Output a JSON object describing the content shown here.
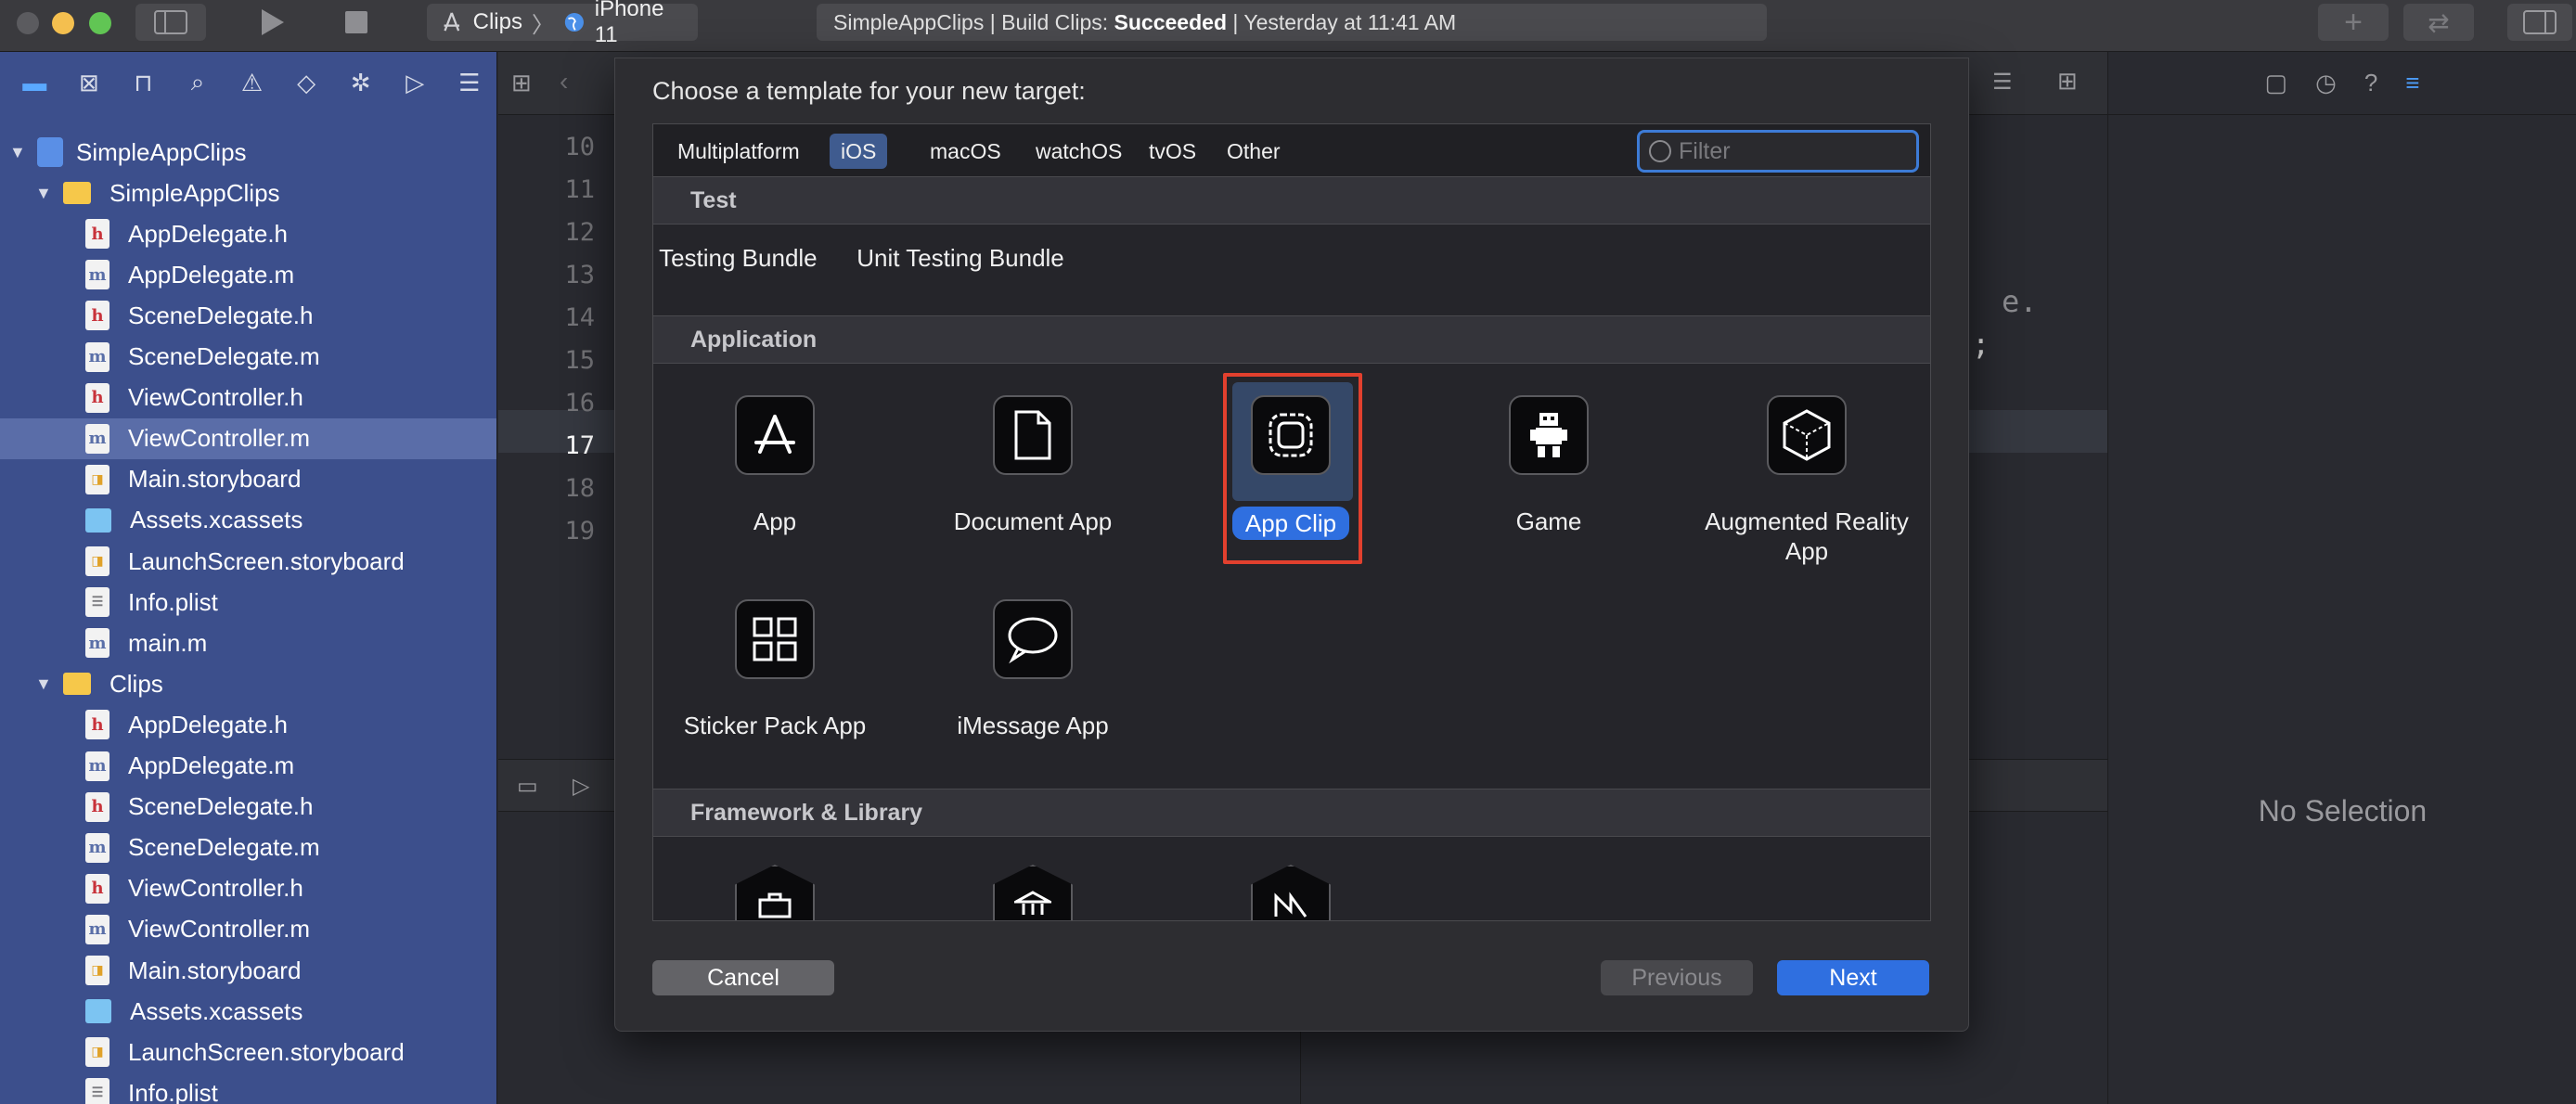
{
  "toolbar": {
    "scheme_target": "Clips",
    "scheme_device": "iPhone 11",
    "status_prefix": "SimpleAppClips | Build Clips: ",
    "status_result": "Succeeded",
    "status_suffix": " | Yesterday at 11:41 AM"
  },
  "navigator": {
    "project": "SimpleAppClips",
    "groups": [
      {
        "name": "SimpleAppClips",
        "files": [
          {
            "name": "AppDelegate.h",
            "kind": "h"
          },
          {
            "name": "AppDelegate.m",
            "kind": "m"
          },
          {
            "name": "SceneDelegate.h",
            "kind": "h"
          },
          {
            "name": "SceneDelegate.m",
            "kind": "m"
          },
          {
            "name": "ViewController.h",
            "kind": "h"
          },
          {
            "name": "ViewController.m",
            "kind": "m",
            "selected": true
          },
          {
            "name": "Main.storyboard",
            "kind": "storyboard"
          },
          {
            "name": "Assets.xcassets",
            "kind": "assets"
          },
          {
            "name": "LaunchScreen.storyboard",
            "kind": "storyboard"
          },
          {
            "name": "Info.plist",
            "kind": "plist"
          },
          {
            "name": "main.m",
            "kind": "m"
          }
        ]
      },
      {
        "name": "Clips",
        "files": [
          {
            "name": "AppDelegate.h",
            "kind": "h"
          },
          {
            "name": "AppDelegate.m",
            "kind": "m"
          },
          {
            "name": "SceneDelegate.h",
            "kind": "h"
          },
          {
            "name": "SceneDelegate.m",
            "kind": "m"
          },
          {
            "name": "ViewController.h",
            "kind": "h"
          },
          {
            "name": "ViewController.m",
            "kind": "m"
          },
          {
            "name": "Main.storyboard",
            "kind": "storyboard"
          },
          {
            "name": "Assets.xcassets",
            "kind": "assets"
          },
          {
            "name": "LaunchScreen.storyboard",
            "kind": "storyboard"
          },
          {
            "name": "Info.plist",
            "kind": "plist"
          }
        ]
      }
    ]
  },
  "editor": {
    "line_numbers": [
      "10",
      "11",
      "12",
      "13",
      "14",
      "15",
      "16",
      "17",
      "18",
      "19"
    ],
    "current_line": "17",
    "fragment_a": "e.",
    "fragment_b": ";"
  },
  "inspector": {
    "no_selection": "No Selection"
  },
  "sheet": {
    "title": "Choose a template for your new target:",
    "platform_tabs": [
      "Multiplatform",
      "iOS",
      "macOS",
      "watchOS",
      "tvOS",
      "Other"
    ],
    "active_tab": "iOS",
    "filter_placeholder": "Filter",
    "sections": {
      "test": "Test",
      "application": "Application",
      "framework": "Framework & Library"
    },
    "test_items": [
      "UI Testing Bundle",
      "Unit Testing Bundle"
    ],
    "app_items": [
      "App",
      "Document App",
      "App Clip",
      "Game",
      "Augmented Reality App",
      "Sticker Pack App",
      "iMessage App"
    ],
    "selected_item": "App Clip",
    "buttons": {
      "cancel": "Cancel",
      "previous": "Previous",
      "next": "Next"
    }
  },
  "colors": {
    "accent": "#2f6fe0",
    "navigator_bg": "#3c4f8c",
    "highlight_red": "#e2402e"
  }
}
